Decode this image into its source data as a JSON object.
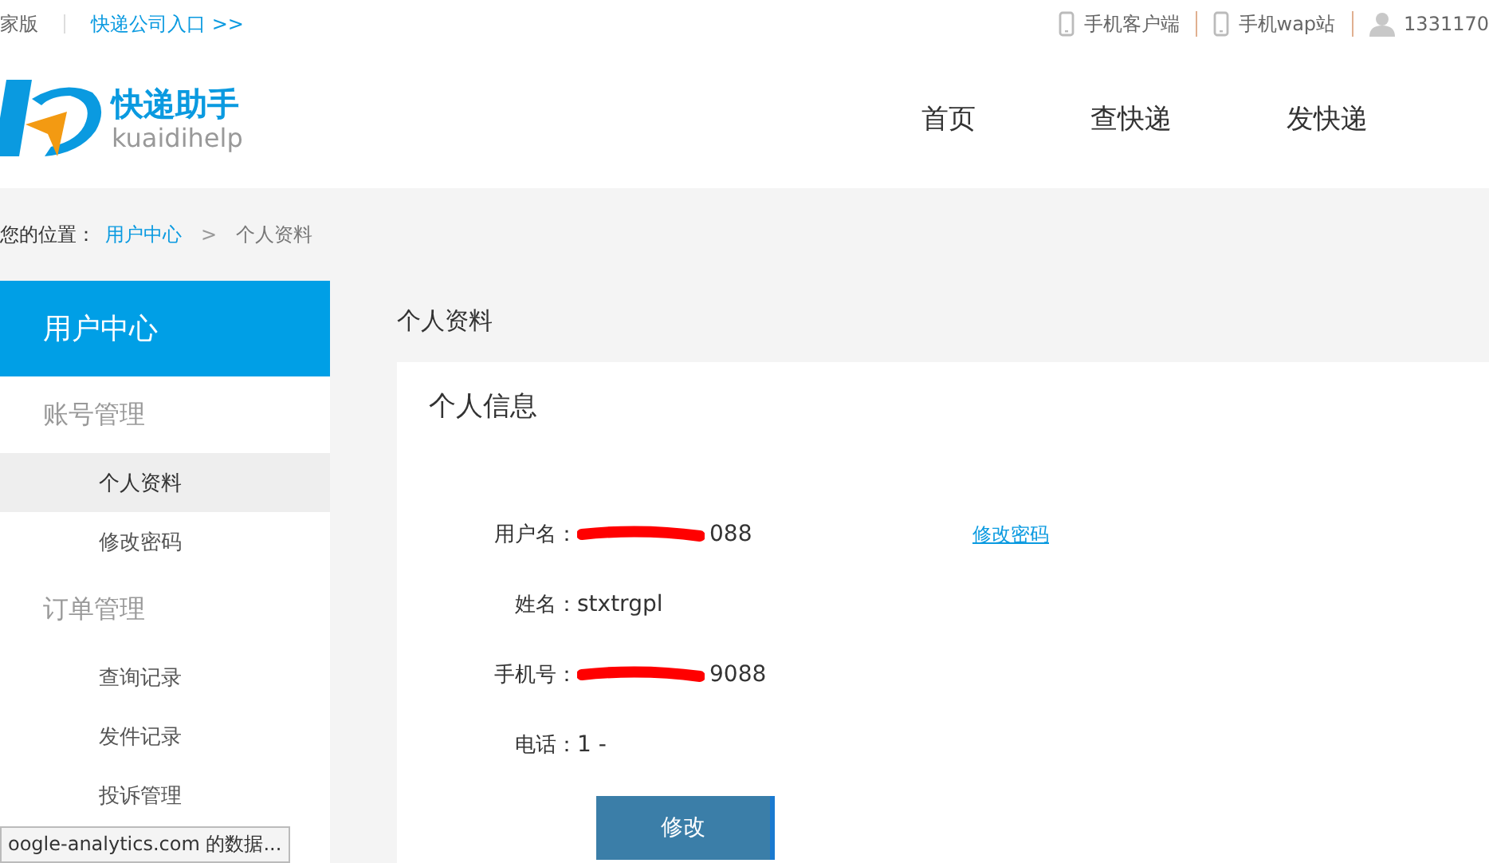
{
  "top_bar": {
    "left_links": [
      "家版",
      "快递公司入口 >>"
    ],
    "right_links": [
      {
        "kind": "phone",
        "label": "手机客户端"
      },
      {
        "kind": "phone",
        "label": "手机wap站"
      },
      {
        "kind": "user",
        "label": "1331170"
      }
    ]
  },
  "header": {
    "logo": {
      "name": "快递助手",
      "subtitle": "kuaidihelp"
    },
    "nav": [
      "首页",
      "查快递",
      "发快递"
    ]
  },
  "breadcrumb": {
    "label": "您的位置：",
    "link": "用户中心",
    "separator": ">",
    "current": "个人资料"
  },
  "sidebar": {
    "title": "用户中心",
    "groups": [
      {
        "title": "账号管理",
        "items": [
          {
            "label": "个人资料",
            "selected": true
          },
          {
            "label": "修改密码",
            "selected": false
          }
        ]
      },
      {
        "title": "订单管理",
        "items": [
          {
            "label": "查询记录",
            "selected": false
          },
          {
            "label": "发件记录",
            "selected": false
          },
          {
            "label": "投诉管理",
            "selected": false
          }
        ]
      }
    ]
  },
  "content": {
    "title": "个人资料",
    "card_title": "个人信息",
    "fields": [
      {
        "label": "用户名：",
        "value": "088",
        "redacted": true,
        "link": "修改密码"
      },
      {
        "label": "姓名：",
        "value": "stxtrgpl",
        "redacted": false
      },
      {
        "label": "手机号：",
        "value": "9088",
        "redacted": true
      },
      {
        "label": "电话：",
        "value": "1 -",
        "redacted": false
      }
    ],
    "button": "修改"
  },
  "status_bar": "oogle-analytics.com 的数据..."
}
